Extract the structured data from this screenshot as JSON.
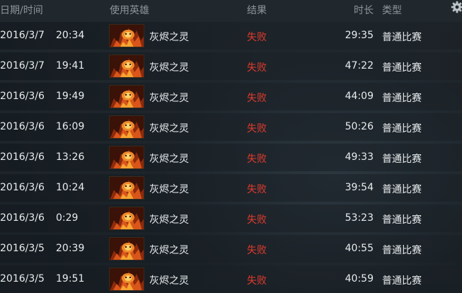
{
  "header": {
    "date_time": "日期/时间",
    "hero": "使用英雄",
    "result": "结果",
    "duration": "时长",
    "type": "类型",
    "settings_icon": "gear-icon"
  },
  "colors": {
    "loss": "#e23a2c",
    "text": "#e8ecee",
    "header_text": "#8d969b"
  },
  "matches": [
    {
      "date": "2016/3/7",
      "time": "20:34",
      "hero_icon": "ember-spirit-portrait",
      "hero": "灰烬之灵",
      "result": "失败",
      "duration": "29:35",
      "type": "普通比赛"
    },
    {
      "date": "2016/3/7",
      "time": "19:41",
      "hero_icon": "ember-spirit-portrait",
      "hero": "灰烬之灵",
      "result": "失败",
      "duration": "47:22",
      "type": "普通比赛"
    },
    {
      "date": "2016/3/6",
      "time": "19:49",
      "hero_icon": "ember-spirit-portrait",
      "hero": "灰烬之灵",
      "result": "失败",
      "duration": "44:09",
      "type": "普通比赛"
    },
    {
      "date": "2016/3/6",
      "time": "16:09",
      "hero_icon": "ember-spirit-portrait",
      "hero": "灰烬之灵",
      "result": "失败",
      "duration": "50:26",
      "type": "普通比赛"
    },
    {
      "date": "2016/3/6",
      "time": "13:26",
      "hero_icon": "ember-spirit-portrait",
      "hero": "灰烬之灵",
      "result": "失败",
      "duration": "49:33",
      "type": "普通比赛"
    },
    {
      "date": "2016/3/6",
      "time": "10:24",
      "hero_icon": "ember-spirit-portrait",
      "hero": "灰烬之灵",
      "result": "失败",
      "duration": "39:54",
      "type": "普通比赛"
    },
    {
      "date": "2016/3/6",
      "time": "0:29",
      "hero_icon": "ember-spirit-portrait",
      "hero": "灰烬之灵",
      "result": "失败",
      "duration": "53:23",
      "type": "普通比赛"
    },
    {
      "date": "2016/3/5",
      "time": "20:39",
      "hero_icon": "ember-spirit-portrait",
      "hero": "灰烬之灵",
      "result": "失败",
      "duration": "40:55",
      "type": "普通比赛"
    },
    {
      "date": "2016/3/5",
      "time": "19:51",
      "hero_icon": "ember-spirit-portrait",
      "hero": "灰烬之灵",
      "result": "失败",
      "duration": "40:59",
      "type": "普通比赛"
    }
  ]
}
